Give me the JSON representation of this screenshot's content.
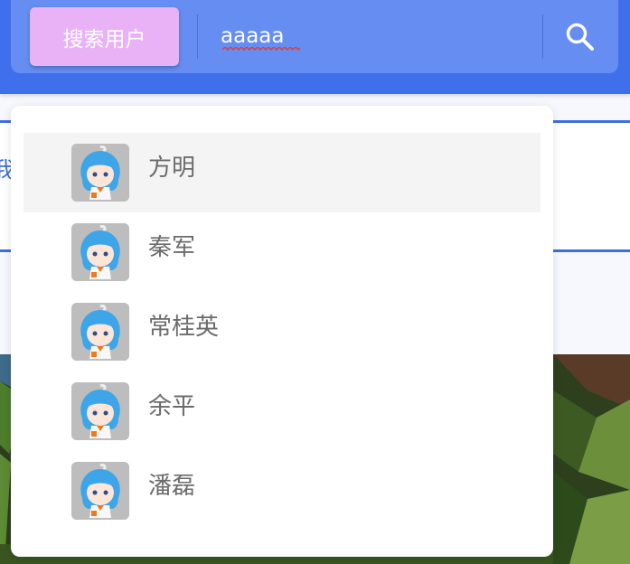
{
  "header": {
    "mode_button_label": "搜索用户",
    "search_value": "aaaaa",
    "search_icon": "search-icon"
  },
  "background": {
    "partial_text": "我"
  },
  "dropdown": {
    "items": [
      {
        "name": "方明",
        "avatar": "anime-girl-avatar",
        "highlighted": true
      },
      {
        "name": "秦军",
        "avatar": "anime-girl-avatar",
        "highlighted": false
      },
      {
        "name": "常桂英",
        "avatar": "anime-girl-avatar",
        "highlighted": false
      },
      {
        "name": "余平",
        "avatar": "anime-girl-avatar",
        "highlighted": false
      },
      {
        "name": "潘磊",
        "avatar": "anime-girl-avatar",
        "highlighted": false
      }
    ]
  },
  "colors": {
    "header_bg": "#3f6fea",
    "searchbar_bg": "#658df2",
    "mode_button_bg": "#e9b2f7",
    "highlight_bg": "#f4f4f4"
  }
}
